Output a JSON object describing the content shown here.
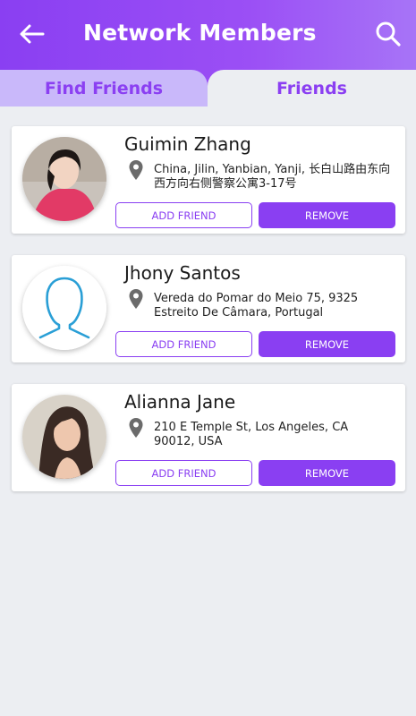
{
  "header": {
    "title": "Network Members"
  },
  "tabs": [
    {
      "label": "Find Friends"
    },
    {
      "label": "Friends"
    }
  ],
  "members": [
    {
      "name": "Guimin Zhang",
      "address_line1": "China, Jilin, Yanbian, Yanji, 长白山路由东向",
      "address_line2": "西方向右侧警察公寓3-17号",
      "add_label": "ADD FRIEND",
      "remove_label": "REMOVE",
      "avatar": "photo"
    },
    {
      "name": "Jhony Santos",
      "address_line1": "Vereda do Pomar do Meio 75, 9325",
      "address_line2": "Estreito De Câmara, Portugal",
      "add_label": "ADD FRIEND",
      "remove_label": "REMOVE",
      "avatar": "placeholder-person-icon"
    },
    {
      "name": "Alianna Jane",
      "address_line1": "210 E Temple St, Los Angeles, CA",
      "address_line2": "90012, USA",
      "add_label": "ADD FRIEND",
      "remove_label": "REMOVE",
      "avatar": "photo"
    }
  ],
  "colors": {
    "accent": "#8a3ff2",
    "tab_inactive_bg": "#c9b8fa",
    "background": "#eceef2",
    "placeholder_icon": "#2a9fd6"
  }
}
